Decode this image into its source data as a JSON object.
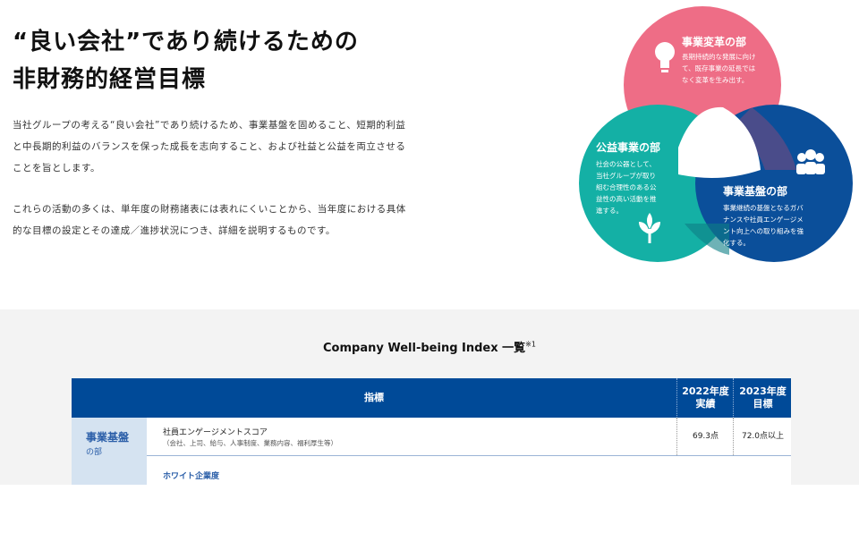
{
  "heading": {
    "line1": "“良い会社”であり続けるための",
    "line2": "非財務的経営目標"
  },
  "intro": {
    "paragraph1_lines": [
      "当社グループの考える“良い会社”であり続けるため、事業基盤を固めること、短期的利益",
      "と中長期的利益のバランスを保った成長を志向すること、および社益と公益を両立させる",
      "ことを旨とします。"
    ],
    "paragraph2_lines": [
      "これらの活動の多くは、単年度の財務諸表には表れにくいことから、当年度における具体",
      "的な目標の設定とその達成／進捗状況につき、詳細を説明するものです。"
    ]
  },
  "venn": {
    "colors": {
      "pink": "#ee6d86",
      "teal": "#14b0a5",
      "navy": "#0b4f9a"
    },
    "transformation": {
      "title": "事業変革の部",
      "lines": [
        "長期持続的な発展に向け",
        "て、既存事業の延長では",
        "なく変革を生み出す。"
      ],
      "icon": "lightbulb-icon"
    },
    "public": {
      "title": "公益事業の部",
      "lines": [
        "社会の公器として、",
        "当社グループが取り",
        "組む合理性のある公",
        "益性の高い活動を推",
        "進する。"
      ],
      "icon": "sprout-icon"
    },
    "foundation": {
      "title": "事業基盤の部",
      "lines": [
        "事業継続の基盤となるガバ",
        "ナンスや社員エンゲージメ",
        "ント向上への取り組みを強",
        "化する。"
      ],
      "icon": "people-icon"
    }
  },
  "index_section": {
    "title": "Company Well-being Index 一覧",
    "note_mark": "※1"
  },
  "table": {
    "header": {
      "indicator": "指標",
      "col2022_l1": "2022年度",
      "col2022_l2": "実績",
      "col2023_l1": "2023年度",
      "col2023_l2": "目標"
    },
    "category": {
      "name": "事業基盤",
      "suffix": "の部"
    },
    "rows": [
      {
        "name": "社員エンゲージメントスコア",
        "sub": "（会社、上司、給与、人事制度、業務内容、福利厚生等）",
        "actual_2022": "69.3点",
        "target_2023": "72.0点以上"
      },
      {
        "name": "ホワイト企業度"
      }
    ]
  }
}
